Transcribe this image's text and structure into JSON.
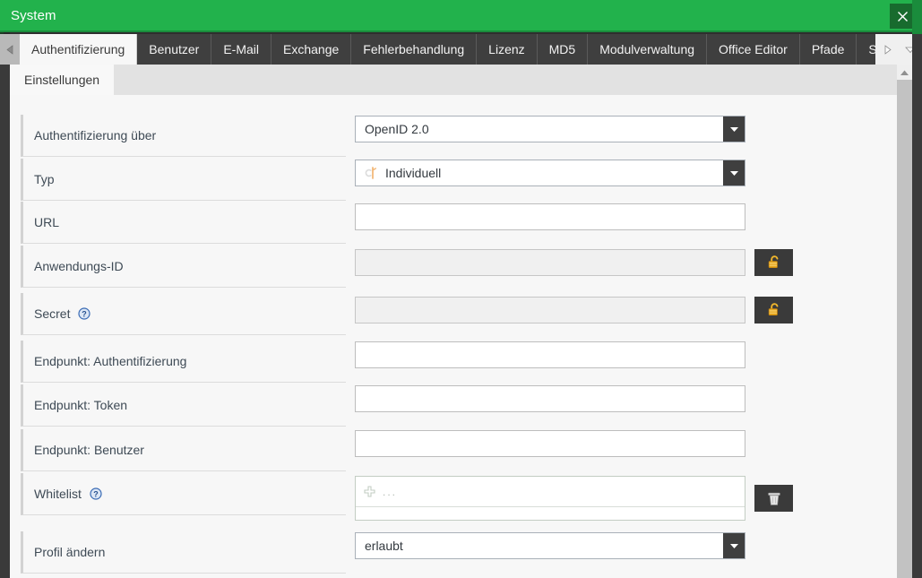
{
  "window": {
    "title": "System",
    "close_label": "×",
    "accent_green": "#22b24c",
    "close_bg": "#186b2e"
  },
  "tabbar": {
    "scroll_left_icon": "triangle-left-icon",
    "scroll_right_icon": "triangle-right-icon",
    "dropdown_icon": "chevron-down-icon",
    "tabs": [
      {
        "label": "Authentifizierung",
        "active": true
      },
      {
        "label": "Benutzer",
        "active": false
      },
      {
        "label": "E-Mail",
        "active": false
      },
      {
        "label": "Exchange",
        "active": false
      },
      {
        "label": "Fehlerbehandlung",
        "active": false
      },
      {
        "label": "Lizenz",
        "active": false
      },
      {
        "label": "MD5",
        "active": false
      },
      {
        "label": "Modulverwaltung",
        "active": false
      },
      {
        "label": "Office Editor",
        "active": false
      },
      {
        "label": "Pfade",
        "active": false
      },
      {
        "label": "Sicherh",
        "active": false
      }
    ]
  },
  "subtabs": [
    {
      "label": "Einstellungen",
      "active": true
    }
  ],
  "form": {
    "rows": [
      {
        "label": "Authentifizierung über",
        "control": "select",
        "value": "OpenID 2.0",
        "has_help": false,
        "icon": null,
        "button": null
      },
      {
        "label": "Typ",
        "control": "select",
        "value": "Individuell",
        "has_help": false,
        "icon": "custom-key-icon",
        "button": null
      },
      {
        "label": "URL",
        "control": "text",
        "value": "",
        "has_help": false,
        "disabled": false,
        "button": null
      },
      {
        "label": "Anwendungs-ID",
        "control": "text",
        "value": "",
        "has_help": false,
        "disabled": true,
        "button": "unlock-icon"
      },
      {
        "label": "Secret",
        "control": "text",
        "value": "",
        "has_help": true,
        "disabled": true,
        "button": "unlock-icon"
      },
      {
        "label": "Endpunkt: Authentifizierung",
        "control": "text",
        "value": "",
        "has_help": false,
        "disabled": false,
        "button": null
      },
      {
        "label": "Endpunkt: Token",
        "control": "text",
        "value": "",
        "has_help": false,
        "disabled": false,
        "button": null
      },
      {
        "label": "Endpunkt: Benutzer",
        "control": "text",
        "value": "",
        "has_help": false,
        "disabled": false,
        "button": null
      },
      {
        "label": "Whitelist",
        "control": "listbox",
        "value": "",
        "add_row_placeholder": "...",
        "has_help": true,
        "button": "trash-icon"
      },
      {
        "label": "Profil ändern",
        "control": "select",
        "value": "erlaubt",
        "has_help": false,
        "icon": null,
        "button": null
      }
    ]
  },
  "scrollbar": {
    "up_arrow_icon": "triangle-up-icon"
  }
}
